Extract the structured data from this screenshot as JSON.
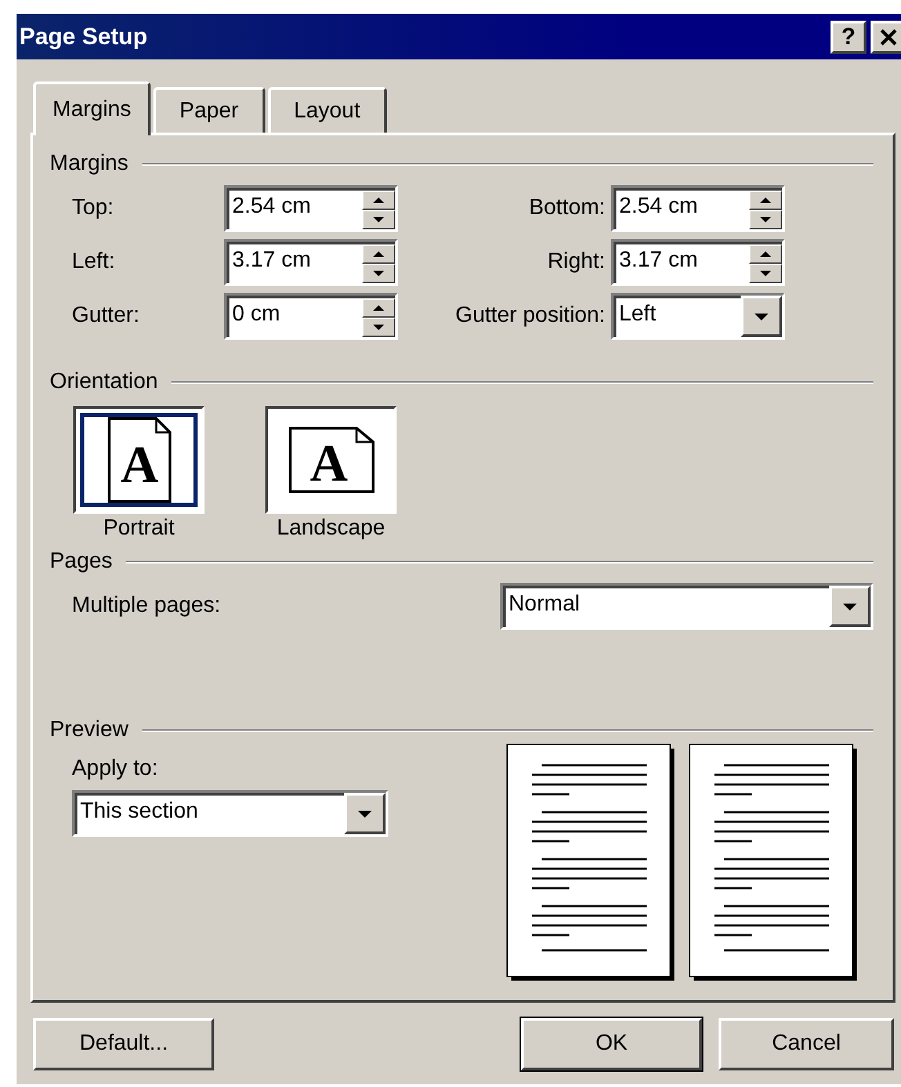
{
  "window": {
    "title": "Page Setup",
    "help_button": "?"
  },
  "tabs": [
    {
      "label": "Margins",
      "selected": true
    },
    {
      "label": "Paper",
      "selected": false
    },
    {
      "label": "Layout",
      "selected": false
    }
  ],
  "margins": {
    "heading": "Margins",
    "fields": [
      {
        "label": "Top:",
        "value": "2.54 cm",
        "kind": "spinner"
      },
      {
        "label": "Bottom:",
        "value": "2.54 cm",
        "kind": "spinner"
      },
      {
        "label": "Left:",
        "value": "3.17 cm",
        "kind": "spinner"
      },
      {
        "label": "Right:",
        "value": "3.17 cm",
        "kind": "spinner"
      },
      {
        "label": "Gutter:",
        "value": "0 cm",
        "kind": "spinner"
      },
      {
        "label": "Gutter position:",
        "value": "Left",
        "kind": "dropdown"
      }
    ]
  },
  "orientation": {
    "heading": "Orientation",
    "options": [
      {
        "label": "Portrait",
        "letter": "A",
        "kind": "portrait",
        "selected": true
      },
      {
        "label": "Landscape",
        "letter": "A",
        "kind": "landscape",
        "selected": false
      }
    ]
  },
  "pages": {
    "heading": "Pages",
    "label": "Multiple pages:",
    "value": "Normal"
  },
  "preview": {
    "heading": "Preview",
    "apply_label": "Apply to:",
    "apply_value": "This section"
  },
  "buttons": [
    {
      "label": "Default...",
      "default": false
    },
    {
      "label": "OK",
      "default": true
    },
    {
      "label": "Cancel",
      "default": false
    }
  ]
}
